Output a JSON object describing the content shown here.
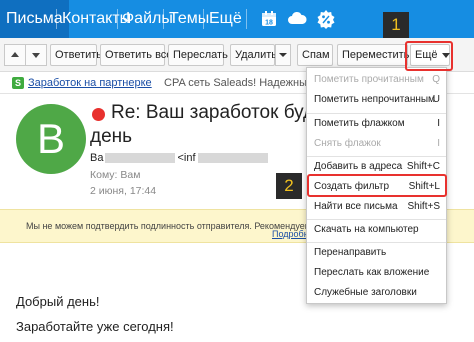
{
  "nav": {
    "items": [
      "Письма",
      "Контакты",
      "Файлы",
      "Темы",
      "Ещё"
    ],
    "icons": [
      "calendar-icon",
      "cloud-icon",
      "discount-icon"
    ],
    "calendar_day": "18"
  },
  "toolbar": {
    "reply": "Ответить",
    "reply_all": "Ответить всем",
    "forward": "Переслать",
    "delete": "Удалить",
    "spam": "Спам",
    "move": "Переместить",
    "more": "Ещё"
  },
  "ad": {
    "badge": "S",
    "link": "Заработок на партнерке",
    "text": "CPA сеть Saleads! Надежный способ заработ"
  },
  "message": {
    "avatar_letter": "B",
    "subject_line1": "Re: Ваш заработок будет со",
    "subject_line2": "день",
    "from_prefix": "Ba",
    "from_email_prefix": "<inf",
    "to": "Кому: Вам",
    "date": "2 июня, 17:44",
    "warning": "Мы не можем подтвердить подлинность отправителя. Рекомендуем вам б",
    "warning_link": "Подробн",
    "body_line1": "Добрый день!",
    "body_line2": "Заработайте уже сегодня!"
  },
  "menu": {
    "items": [
      {
        "label": "Пометить прочитанным",
        "key": "Q",
        "disabled": true
      },
      {
        "label": "Пометить непрочитанным",
        "key": "U",
        "disabled": false
      },
      {
        "label": "Пометить флажком",
        "key": "I",
        "disabled": false
      },
      {
        "label": "Снять флажок",
        "key": "I",
        "disabled": true
      },
      {
        "label": "Добавить в адреса",
        "key": "Shift+C",
        "disabled": false
      },
      {
        "label": "Создать фильтр",
        "key": "Shift+L",
        "disabled": false
      },
      {
        "label": "Найти все письма",
        "key": "Shift+S",
        "disabled": false
      },
      {
        "label": "Скачать на компьютер",
        "key": "",
        "disabled": false
      },
      {
        "label": "Перенаправить",
        "key": "",
        "disabled": false
      },
      {
        "label": "Переслать как вложение",
        "key": "",
        "disabled": false
      },
      {
        "label": "Служебные заголовки",
        "key": "",
        "disabled": false
      }
    ]
  },
  "annotations": {
    "step1": "1",
    "step2": "2",
    "highlight_color": "#e8312e"
  },
  "colors": {
    "topbar": "#168de2",
    "avatar": "#4fa847",
    "unread_dot": "#e8312e"
  }
}
